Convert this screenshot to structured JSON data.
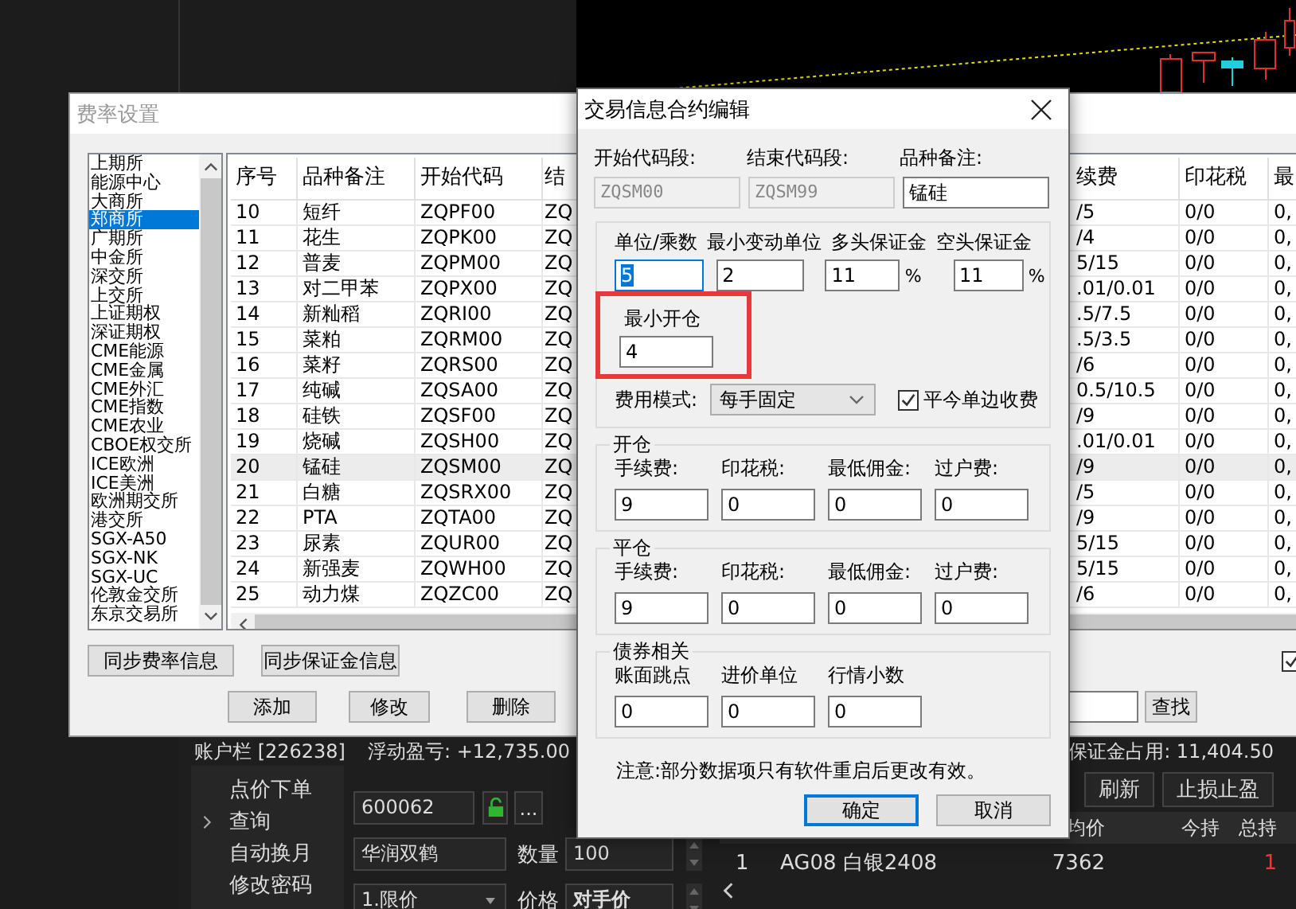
{
  "fee_window": {
    "title": "费率设置",
    "active": false,
    "exchanges": [
      {
        "label": "上期所",
        "selected": false
      },
      {
        "label": "能源中心",
        "selected": false
      },
      {
        "label": "大商所",
        "selected": false
      },
      {
        "label": "郑商所",
        "selected": true
      },
      {
        "label": "广期所",
        "selected": false
      },
      {
        "label": "中金所",
        "selected": false
      },
      {
        "label": "深交所",
        "selected": false
      },
      {
        "label": "上交所",
        "selected": false
      },
      {
        "label": "上证期权",
        "selected": false
      },
      {
        "label": "深证期权",
        "selected": false
      },
      {
        "label": "CME能源",
        "selected": false
      },
      {
        "label": "CME金属",
        "selected": false
      },
      {
        "label": "CME外汇",
        "selected": false
      },
      {
        "label": "CME指数",
        "selected": false
      },
      {
        "label": "CME农业",
        "selected": false
      },
      {
        "label": "CBOE权交所",
        "selected": false
      },
      {
        "label": "ICE欧洲",
        "selected": false
      },
      {
        "label": "ICE美洲",
        "selected": false
      },
      {
        "label": "欧洲期交所",
        "selected": false
      },
      {
        "label": "港交所",
        "selected": false
      },
      {
        "label": "SGX-A50",
        "selected": false
      },
      {
        "label": "SGX-NK",
        "selected": false
      },
      {
        "label": "SGX-UC",
        "selected": false
      },
      {
        "label": "伦敦金交所",
        "selected": false
      },
      {
        "label": "东京交易所",
        "selected": false
      }
    ],
    "table": {
      "columns": [
        "序号",
        "品种备注",
        "开始代码",
        "结",
        "续费",
        "印花税",
        "最"
      ],
      "rows": [
        {
          "cells": [
            "10",
            "短纤",
            "ZQPF00",
            "ZQ",
            "/5",
            "0/0",
            "0,"
          ],
          "selected": false
        },
        {
          "cells": [
            "11",
            "花生",
            "ZQPK00",
            "ZQ",
            "/4",
            "0/0",
            "0,"
          ],
          "selected": false
        },
        {
          "cells": [
            "12",
            "普麦",
            "ZQPM00",
            "ZQ",
            "5/15",
            "0/0",
            "0,"
          ],
          "selected": false
        },
        {
          "cells": [
            "13",
            "对二甲苯",
            "ZQPX00",
            "ZQ",
            ".01/0.01",
            "0/0",
            "0,"
          ],
          "selected": false
        },
        {
          "cells": [
            "14",
            "新籼稻",
            "ZQRI00",
            "ZQ",
            ".5/7.5",
            "0/0",
            "0,"
          ],
          "selected": false
        },
        {
          "cells": [
            "15",
            "菜粕",
            "ZQRM00",
            "ZQ",
            ".5/3.5",
            "0/0",
            "0,"
          ],
          "selected": false
        },
        {
          "cells": [
            "16",
            "菜籽",
            "ZQRS00",
            "ZQ",
            "/6",
            "0/0",
            "0,"
          ],
          "selected": false
        },
        {
          "cells": [
            "17",
            "纯碱",
            "ZQSA00",
            "ZQ",
            "0.5/10.5",
            "0/0",
            "0,"
          ],
          "selected": false
        },
        {
          "cells": [
            "18",
            "硅铁",
            "ZQSF00",
            "ZQ",
            "/9",
            "0/0",
            "0,"
          ],
          "selected": false
        },
        {
          "cells": [
            "19",
            "烧碱",
            "ZQSH00",
            "ZQ",
            ".01/0.01",
            "0/0",
            "0,"
          ],
          "selected": false
        },
        {
          "cells": [
            "20",
            "锰硅",
            "ZQSM00",
            "ZQ",
            "/9",
            "0/0",
            "0,"
          ],
          "selected": true
        },
        {
          "cells": [
            "21",
            "白糖",
            "ZQSRX00",
            "ZQ",
            "/5",
            "0/0",
            "0,"
          ],
          "selected": false
        },
        {
          "cells": [
            "22",
            "PTA",
            "ZQTA00",
            "ZQ",
            "/9",
            "0/0",
            "0,"
          ],
          "selected": false
        },
        {
          "cells": [
            "23",
            "尿素",
            "ZQUR00",
            "ZQ",
            "5/15",
            "0/0",
            "0,"
          ],
          "selected": false
        },
        {
          "cells": [
            "24",
            "新强麦",
            "ZQWH00",
            "ZQ",
            "5/15",
            "0/0",
            "0,"
          ],
          "selected": false
        },
        {
          "cells": [
            "25",
            "动力煤",
            "ZQZC00",
            "ZQ",
            "/6",
            "0/0",
            "0,"
          ],
          "selected": false
        }
      ]
    },
    "sync_buttons": [
      "同步费率信息",
      "同步保证金信息"
    ],
    "option_checkbox": {
      "checked": true
    },
    "action_buttons": [
      "添加",
      "修改",
      "删除"
    ],
    "search_button": "查找"
  },
  "dialog": {
    "title": "交易信息合约编辑",
    "code_fields": [
      {
        "label": "开始代码段:",
        "value": "ZQSM00",
        "disabled": true
      },
      {
        "label": "结束代码段:",
        "value": "ZQSM99",
        "disabled": true
      },
      {
        "label": "品种备注:",
        "value": "锰硅",
        "disabled": false
      }
    ],
    "params": [
      {
        "label": "单位/乘数",
        "value": "5",
        "focused": true
      },
      {
        "label": "最小变动单位",
        "value": "2",
        "focused": false
      },
      {
        "label": "多头保证金",
        "value": "11",
        "unit": "%",
        "focused": false
      },
      {
        "label": "空头保证金",
        "value": "11",
        "unit": "%",
        "focused": false
      }
    ],
    "min_open": {
      "label": "最小开仓",
      "value": "4",
      "highlighted": true
    },
    "fee_mode": {
      "label": "费用模式:",
      "value": "每手固定"
    },
    "one_side_fee": {
      "label": "平今单边收费",
      "checked": true
    },
    "groups": [
      {
        "title": "开仓",
        "fields": [
          {
            "label": "手续费:",
            "value": "9"
          },
          {
            "label": "印花税:",
            "value": "0"
          },
          {
            "label": "最低佣金:",
            "value": "0"
          },
          {
            "label": "过户费:",
            "value": "0"
          }
        ]
      },
      {
        "title": "平仓",
        "fields": [
          {
            "label": "手续费:",
            "value": "9"
          },
          {
            "label": "印花税:",
            "value": "0"
          },
          {
            "label": "最低佣金:",
            "value": "0"
          },
          {
            "label": "过户费:",
            "value": "0"
          }
        ]
      },
      {
        "title": "债券相关",
        "fields": [
          {
            "label": "账面跳点",
            "value": "0"
          },
          {
            "label": "进价单位",
            "value": "0"
          },
          {
            "label": "行情小数",
            "value": "0"
          }
        ]
      }
    ],
    "note": "注意:部分数据项只有软件重启后更改有效。",
    "buttons": [
      {
        "label": "确定",
        "default": true
      },
      {
        "label": "取消",
        "default": false
      }
    ]
  },
  "account_bar": {
    "account": "账户栏 [226238]",
    "floating_pnl": "浮动盈亏: +12,735.00",
    "margin": "保证金占用: 11,404.50"
  },
  "nav": [
    {
      "label": "点价下单",
      "expandable": false
    },
    {
      "label": "查询",
      "expandable": true
    },
    {
      "label": "自动换月",
      "expandable": false
    },
    {
      "label": "修改密码",
      "expandable": false
    }
  ],
  "order_form": {
    "code": "600062",
    "more": "...",
    "name": "华润双鹤",
    "quantity_label": "数量",
    "quantity": "100",
    "order_type": "1.限价",
    "price_label": "价格",
    "price": "对手价"
  },
  "toolbar": [
    "刷新",
    "止损止盈"
  ],
  "positions": {
    "columns": [
      "均价",
      "今持",
      "总持"
    ],
    "rows": [
      {
        "index": "1",
        "contract": "AG08 白银2408",
        "price": "7362",
        "total": "1"
      }
    ]
  }
}
